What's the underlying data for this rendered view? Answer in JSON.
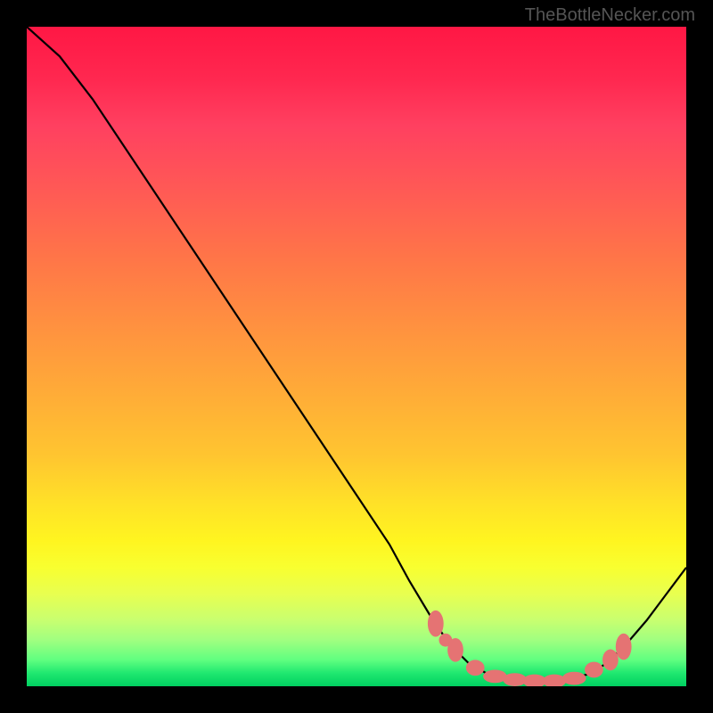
{
  "watermark": "TheBottleNecker.com",
  "chart_data": {
    "type": "line",
    "title": "",
    "xlabel": "",
    "ylabel": "",
    "xlim": [
      0,
      100
    ],
    "ylim": [
      0,
      100
    ],
    "curve": {
      "name": "bottleneck-curve",
      "points": [
        {
          "x": 0,
          "y": 100
        },
        {
          "x": 5,
          "y": 95.5
        },
        {
          "x": 10,
          "y": 89
        },
        {
          "x": 15,
          "y": 81.5
        },
        {
          "x": 20,
          "y": 74
        },
        {
          "x": 25,
          "y": 66.5
        },
        {
          "x": 30,
          "y": 59
        },
        {
          "x": 35,
          "y": 51.5
        },
        {
          "x": 40,
          "y": 44
        },
        {
          "x": 45,
          "y": 36.5
        },
        {
          "x": 50,
          "y": 29
        },
        {
          "x": 55,
          "y": 21.5
        },
        {
          "x": 58,
          "y": 16
        },
        {
          "x": 61,
          "y": 11
        },
        {
          "x": 64,
          "y": 6.5
        },
        {
          "x": 67,
          "y": 3.5
        },
        {
          "x": 70,
          "y": 1.8
        },
        {
          "x": 73,
          "y": 1.0
        },
        {
          "x": 76,
          "y": 0.8
        },
        {
          "x": 79,
          "y": 0.8
        },
        {
          "x": 82,
          "y": 1.0
        },
        {
          "x": 85,
          "y": 1.8
        },
        {
          "x": 88,
          "y": 3.5
        },
        {
          "x": 91,
          "y": 6.5
        },
        {
          "x": 94,
          "y": 10
        },
        {
          "x": 97,
          "y": 14
        },
        {
          "x": 100,
          "y": 18
        }
      ]
    },
    "markers": {
      "name": "optimal-range-markers",
      "points": [
        {
          "x": 62,
          "y": 9.5,
          "rx": 1.2,
          "ry": 2.0
        },
        {
          "x": 63.5,
          "y": 7,
          "rx": 1.0,
          "ry": 1.0
        },
        {
          "x": 65,
          "y": 5.5,
          "rx": 1.2,
          "ry": 1.8
        },
        {
          "x": 68,
          "y": 2.8,
          "rx": 1.4,
          "ry": 1.2
        },
        {
          "x": 71,
          "y": 1.5,
          "rx": 1.8,
          "ry": 1.0
        },
        {
          "x": 74,
          "y": 1.0,
          "rx": 1.8,
          "ry": 1.0
        },
        {
          "x": 77,
          "y": 0.8,
          "rx": 1.8,
          "ry": 1.0
        },
        {
          "x": 80,
          "y": 0.8,
          "rx": 1.8,
          "ry": 1.0
        },
        {
          "x": 83,
          "y": 1.2,
          "rx": 1.8,
          "ry": 1.0
        },
        {
          "x": 86,
          "y": 2.5,
          "rx": 1.4,
          "ry": 1.2
        },
        {
          "x": 88.5,
          "y": 4.0,
          "rx": 1.2,
          "ry": 1.6
        },
        {
          "x": 90.5,
          "y": 6.0,
          "rx": 1.2,
          "ry": 2.0
        }
      ]
    },
    "colors": {
      "curve": "#000000",
      "markers": "#e57373",
      "background_top": "#ff1744",
      "background_bottom": "#00d060"
    }
  }
}
